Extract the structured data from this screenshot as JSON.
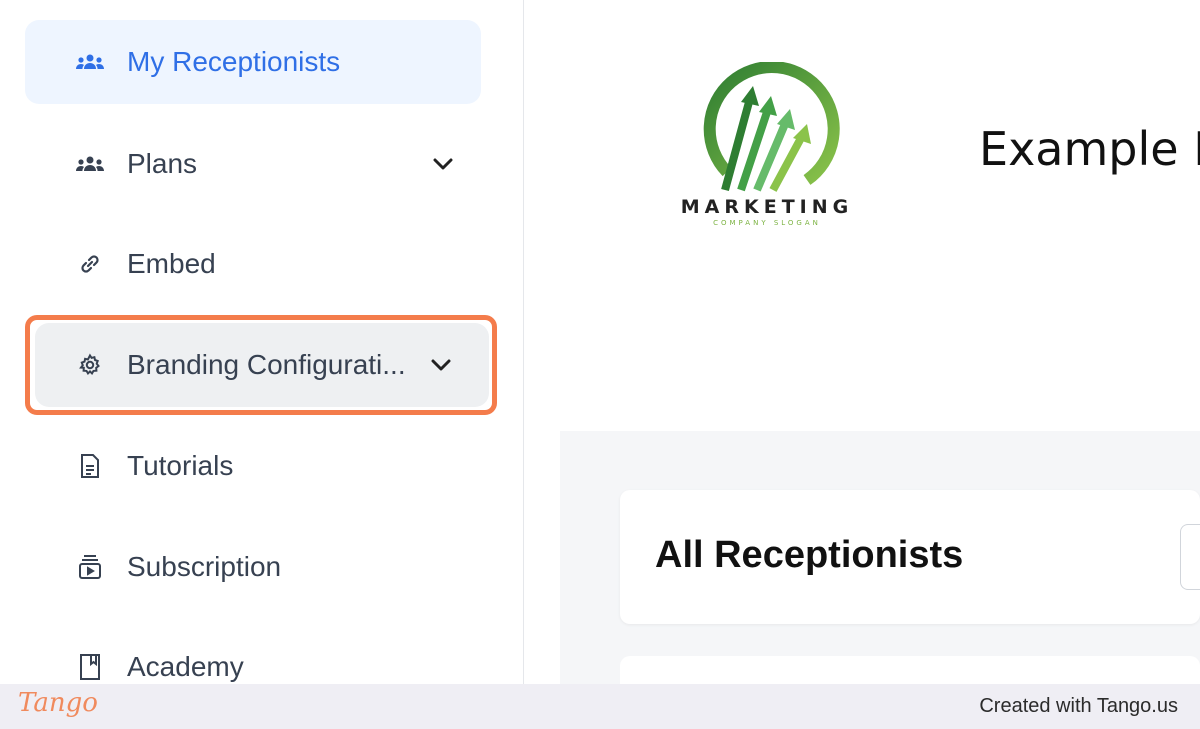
{
  "sidebar": {
    "items": [
      {
        "label": "My Receptionists",
        "icon": "users-icon"
      },
      {
        "label": "Plans",
        "icon": "users-icon"
      },
      {
        "label": "Embed",
        "icon": "link-icon"
      },
      {
        "label": "Branding Configurati...",
        "icon": "gear-icon"
      },
      {
        "label": "Tutorials",
        "icon": "document-icon"
      },
      {
        "label": "Subscription",
        "icon": "subscription-icon"
      },
      {
        "label": "Academy",
        "icon": "book-icon"
      }
    ]
  },
  "header": {
    "company_name": "Example D",
    "logo_text": "MARKETING",
    "logo_slogan": "COMPANY SLOGAN"
  },
  "main": {
    "card_title": "All Receptionists"
  },
  "footer": {
    "brand": "Tango",
    "credit": "Created with Tango.us"
  },
  "colors": {
    "active_text": "#2f6fe6",
    "active_bg": "#eef5ff",
    "highlight": "#f47c4b",
    "logo_green": "#3f9a3a"
  }
}
